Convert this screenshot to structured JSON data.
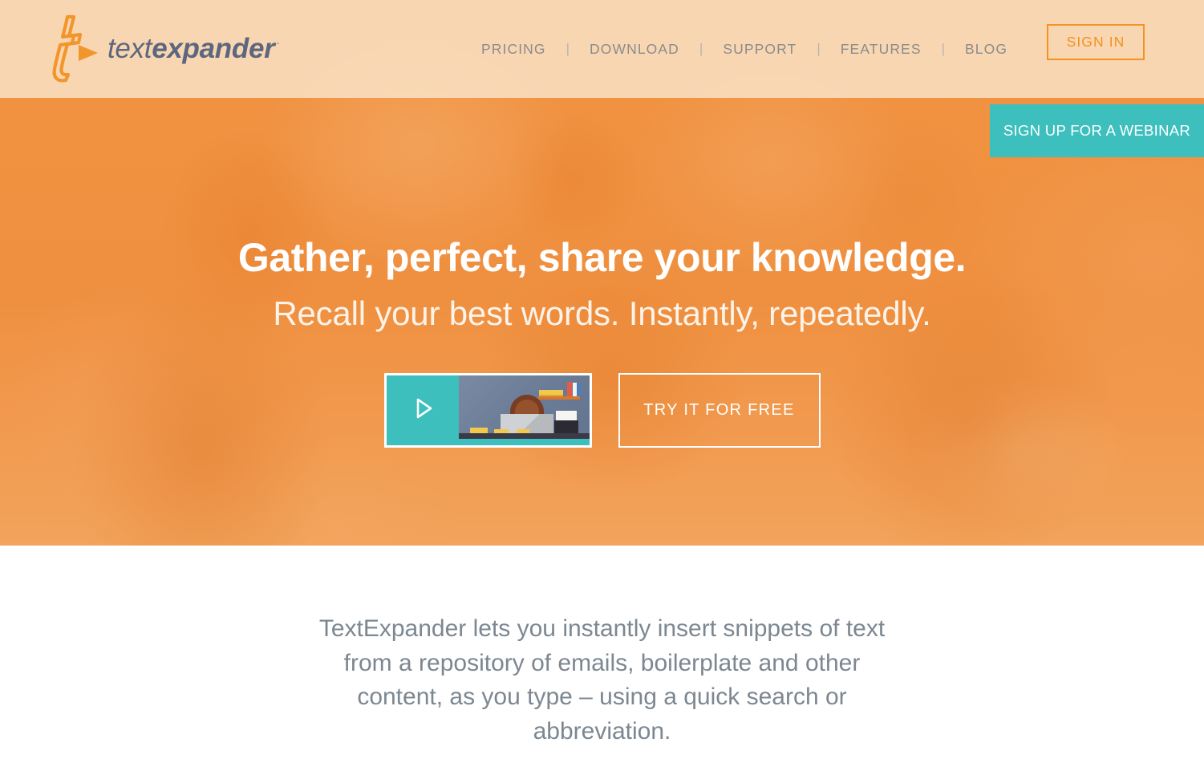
{
  "brand": {
    "logo_icon": "textexpander-t-arrow-logo",
    "name_light": "text",
    "name_bold": "expander",
    "registered_mark": "·",
    "accent_orange": "#f0921f",
    "hero_orange": "#ef9244",
    "teal": "#3cbfbd",
    "header_bg": "#fbe4c9",
    "nav_text": "#8b8b8b",
    "body_text": "#7c8791"
  },
  "header": {
    "nav": [
      {
        "label": "PRICING"
      },
      {
        "label": "DOWNLOAD"
      },
      {
        "label": "SUPPORT"
      },
      {
        "label": "FEATURES"
      },
      {
        "label": "BLOG"
      }
    ],
    "separator": "|",
    "sign_in_label": "SIGN IN"
  },
  "hero": {
    "webinar_banner_label": "SIGN UP FOR A WEBINAR",
    "title": "Gather, perfect, share your knowledge.",
    "subtitle": "Recall your best words. Instantly, repeatedly.",
    "video": {
      "play_icon": "play-triangle-icon",
      "thumbnail_alt": "person-at-laptop-illustration"
    },
    "try_button_label": "TRY IT FOR FREE"
  },
  "intro": {
    "paragraph": "TextExpander lets you instantly insert snippets of text from a repository of emails, boilerplate and other content, as you type – using a quick search or abbreviation."
  }
}
